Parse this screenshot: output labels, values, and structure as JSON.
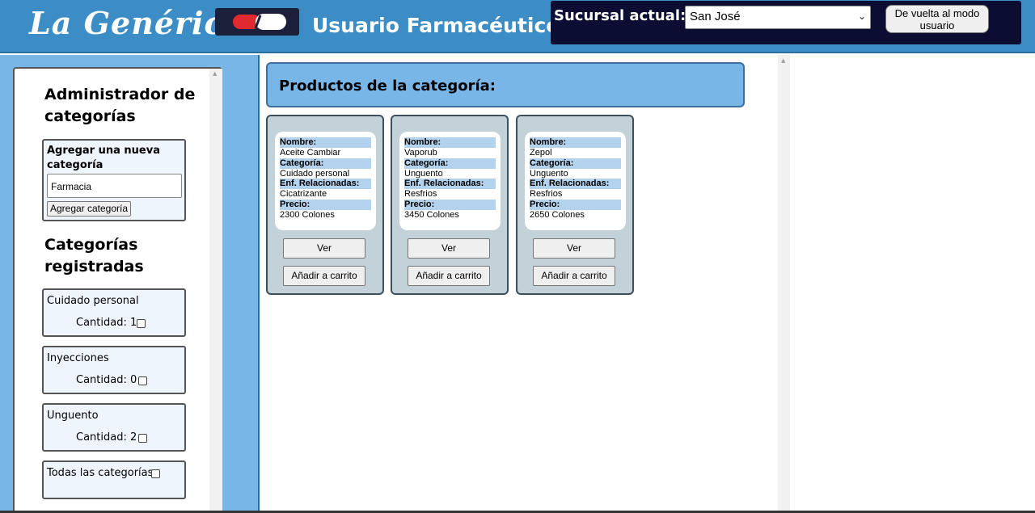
{
  "header": {
    "brand": "La Genérica",
    "role_title": "Usuario Farmacéutico",
    "branch_label": "Sucursal actual:",
    "branch_selected": "San José",
    "back_button": "De vuelta al modo usuario"
  },
  "sidebar": {
    "admin_title_line1": "Administrador de",
    "admin_title_line2": "categorías",
    "add_box": {
      "title": "Agregar una nueva categoría",
      "input_value": "Farmacia",
      "button": "Agregar categoría"
    },
    "registered_title_line1": "Categorías",
    "registered_title_line2": "registradas",
    "categories": [
      {
        "name": "Cuidado personal",
        "count_label": "Cantidad: 1"
      },
      {
        "name": "Inyecciones",
        "count_label": "Cantidad: 0"
      },
      {
        "name": "Unguento",
        "count_label": "Cantidad: 2"
      }
    ],
    "all_categories": "Todas las categorías"
  },
  "main": {
    "section_title": "Productos de la categoría:",
    "labels": {
      "name": "Nombre:",
      "category": "Categoría:",
      "diseases": "Enf. Relacionadas:",
      "price": "Precio:"
    },
    "view_button": "Ver",
    "cart_button": "Añadir a carrito",
    "products": [
      {
        "name": "Aceite Cambiar",
        "category": "Cuidado personal",
        "diseases": "Cicatrizante",
        "price": "2300 Colones"
      },
      {
        "name": "Vaporub",
        "category": "Unguento",
        "diseases": "Resfrios",
        "price": "3450 Colones"
      },
      {
        "name": "Zepol",
        "category": "Unguento",
        "diseases": "Resfrios",
        "price": "2650 Colones"
      }
    ]
  },
  "colors": {
    "header_bg": "#3c8dc5",
    "branch_panel_bg": "#0c0d33",
    "sidebar_bg": "#79b6e8",
    "card_bg": "#c3d1d9",
    "label_highlight": "#b3d2ee"
  }
}
